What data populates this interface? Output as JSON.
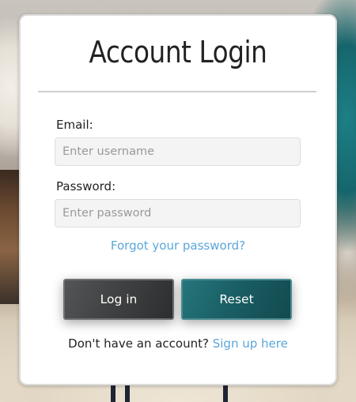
{
  "login": {
    "title": "Account Login",
    "email_label": "Email:",
    "email_placeholder": "Enter username",
    "password_label": "Password:",
    "password_placeholder": "Enter password",
    "forgot_link": "Forgot your password?",
    "login_button": "Log in",
    "reset_button": "Reset",
    "signup_prompt": "Don't have an account?",
    "signup_link": "Sign up here"
  },
  "colors": {
    "link": "#5aa6da",
    "login_button": "#414243",
    "reset_button": "#1a5f65"
  }
}
